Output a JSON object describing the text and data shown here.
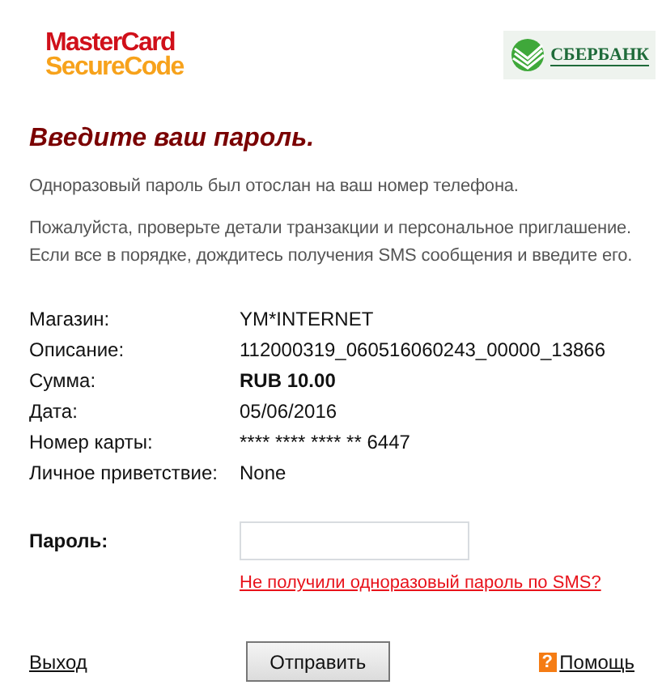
{
  "logos": {
    "mastercard": {
      "line_1": "MasterCard",
      "line_2": "SecureCode"
    },
    "bank": "СБЕРБАНК"
  },
  "title": "Введите ваш пароль.",
  "paragraphs": [
    "Одноразовый пароль был отослан на ваш номер телефона.",
    "Пожалуйста, проверьте детали транзакции и персональное приглашение. Если все в порядке, дождитесь получения SMS сообщения и введите его."
  ],
  "details": [
    {
      "label": "Магазин:",
      "value": "YM*INTERNET",
      "bold": false
    },
    {
      "label": "Описание:",
      "value": "112000319_060516060243_00000_13866",
      "bold": false
    },
    {
      "label": "Сумма:",
      "value": "RUB 10.00",
      "bold": true
    },
    {
      "label": "Дата:",
      "value": "05/06/2016",
      "bold": false
    },
    {
      "label": "Номер карты:",
      "value": "**** **** **** ** 6447",
      "bold": false
    },
    {
      "label": "Личное приветствие:",
      "value": "None",
      "bold": false
    }
  ],
  "password": {
    "label": "Пароль:",
    "resend_link": "Не получили одноразовый пароль по SMS?"
  },
  "footer": {
    "exit_link": "Выход",
    "submit_button": "Отправить",
    "help_icon": "?",
    "help_link": "Помощь"
  }
}
